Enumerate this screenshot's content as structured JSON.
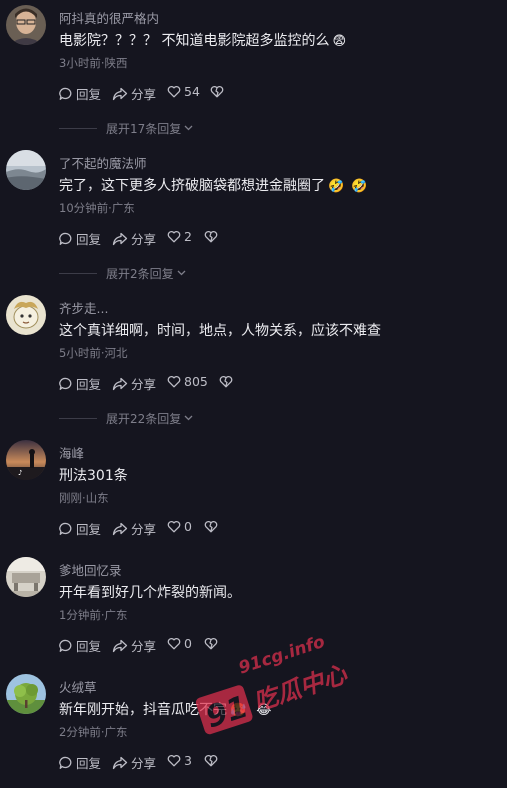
{
  "comments": [
    {
      "username": "阿抖真的很严格内",
      "text": "电影院？？？？ 不知道电影院超多监控的么",
      "emojis": [
        "😨"
      ],
      "meta": "3小时前·陕西",
      "reply_label": "回复",
      "share_label": "分享",
      "likes": "54",
      "expand_label": "展开17条回复",
      "avatar": "person-portrait"
    },
    {
      "username": "了不起的魔法师",
      "text": "完了，这下更多人挤破脑袋都想进金融圈了",
      "emojis": [
        "🤣",
        "🤣"
      ],
      "meta": "10分钟前·广东",
      "reply_label": "回复",
      "share_label": "分享",
      "likes": "2",
      "expand_label": "展开2条回复",
      "avatar": "sky-landscape"
    },
    {
      "username": "齐步走...",
      "text": "这个真详细啊，时间，地点，人物关系，应该不难查",
      "emojis": [],
      "meta": "5小时前·河北",
      "reply_label": "回复",
      "share_label": "分享",
      "likes": "805",
      "expand_label": "展开22条回复",
      "avatar": "cartoon-character"
    },
    {
      "username": "海峰",
      "text": "刑法301条",
      "emojis": [],
      "meta": "刚刚·山东",
      "reply_label": "回复",
      "share_label": "分享",
      "likes": "0",
      "avatar": "sunset-silhouette"
    },
    {
      "username": "爹地回忆录",
      "text": "开年看到好几个炸裂的新闻。",
      "emojis": [],
      "meta": "1分钟前·广东",
      "reply_label": "回复",
      "share_label": "分享",
      "likes": "0",
      "avatar": "room-photo"
    },
    {
      "username": "火绒草",
      "text": "新年刚开始，抖音瓜吃不完",
      "emojis": [
        "🥵",
        "😂"
      ],
      "meta": "2分钟前·广东",
      "reply_label": "回复",
      "share_label": "分享",
      "likes": "3",
      "avatar": "tree-landscape"
    }
  ],
  "watermark": {
    "url": "91cg.info",
    "number": "91",
    "text": "吃瓜中心",
    "color": "#e0304e"
  },
  "colors": {
    "background": "#15151f",
    "secondary_text": "#7e7e8a"
  }
}
